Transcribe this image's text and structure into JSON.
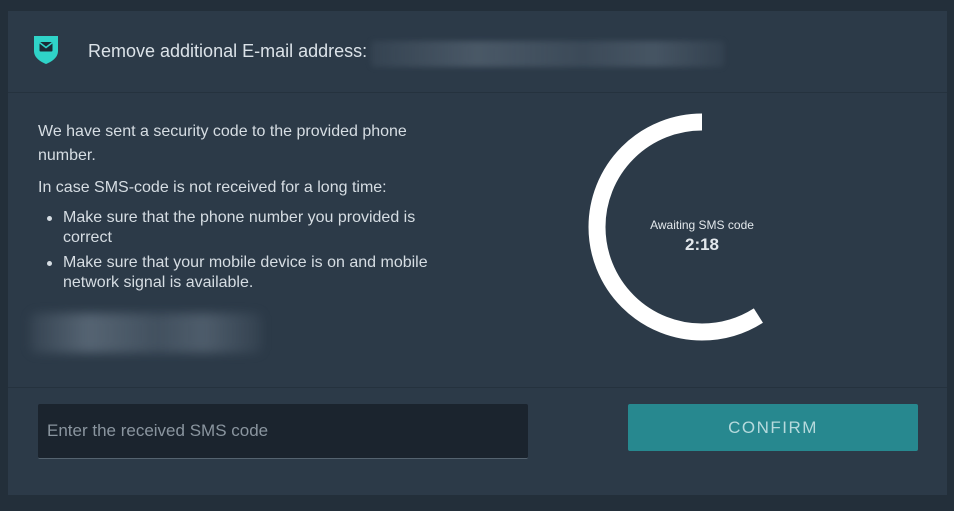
{
  "header": {
    "title": "Remove additional E-mail address:",
    "icon": "shield-mail-icon"
  },
  "message": {
    "sent": "We have sent a security code to the provided phone number.",
    "intro": "In case SMS-code is not received for a long time:",
    "tips": [
      "Make sure that the phone number you provided is correct",
      "Make sure that your mobile device is on and mobile network signal is available."
    ]
  },
  "timer": {
    "label": "Awaiting SMS code",
    "value": "2:18",
    "progress": 0.59
  },
  "form": {
    "sms_placeholder": "Enter the received SMS code",
    "sms_value": "",
    "confirm_label": "CONFIRM"
  },
  "colors": {
    "accent": "#27888f",
    "shield": "#2fd3c8",
    "ring": "#ffffff"
  }
}
